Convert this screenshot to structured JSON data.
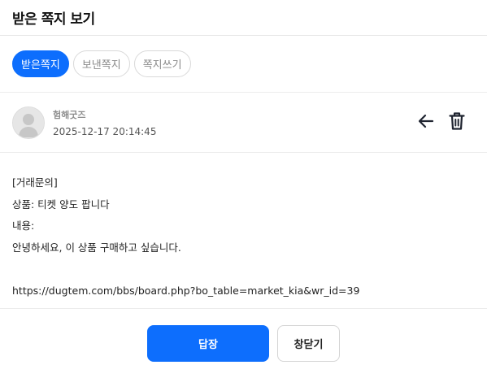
{
  "header": {
    "title": "받은 쪽지 보기"
  },
  "tabs": [
    {
      "label": "받은쪽지",
      "active": true
    },
    {
      "label": "보낸쪽지",
      "active": false
    },
    {
      "label": "쪽지쓰기",
      "active": false
    }
  ],
  "sender": {
    "name": "험해굿즈",
    "date": "2025-12-17 20:14:45",
    "avatar_icon": "default-user-avatar"
  },
  "actions": {
    "back_icon": "arrow-left-icon",
    "delete_icon": "trash-icon"
  },
  "message": {
    "lines": [
      "[거래문의]",
      "상품: 티켓 양도 팝니다",
      "내용:",
      "안녕하세요, 이 상품 구매하고 싶습니다.",
      "",
      "https://dugtem.com/bbs/board.php?bo_table=market_kia&wr_id=39"
    ]
  },
  "footer": {
    "reply_label": "답장",
    "close_label": "창닫기"
  },
  "colors": {
    "accent": "#0d6efd",
    "border": "#ececec",
    "muted_text": "#8c8c8c"
  }
}
